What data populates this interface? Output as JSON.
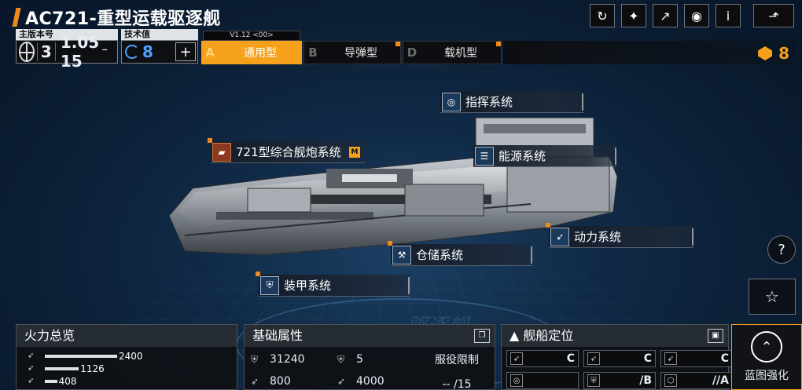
{
  "header": {
    "title": "AC721-重型运载驱逐舰"
  },
  "version_panel": {
    "label": "主版本号",
    "major": "3",
    "minor": "1.05",
    "sub": "15"
  },
  "tech_panel": {
    "label": "技术值",
    "value": "8"
  },
  "tabs": {
    "version_tag": "V1.12 <00>",
    "items": [
      {
        "letter": "A",
        "label": "通用型",
        "active": true
      },
      {
        "letter": "B",
        "label": "导弹型",
        "active": false
      },
      {
        "letter": "D",
        "label": "载机型",
        "active": false
      }
    ]
  },
  "currency": {
    "value": "8",
    "color": "#f5a11c"
  },
  "systems": {
    "command": "指挥系统",
    "energy": "能源系统",
    "cannon": "721型综合舰炮系统",
    "cannon_badge": "M",
    "power": "动力系统",
    "storage": "仓储系统",
    "armor": "装甲系统"
  },
  "floor_text": "驱逐舰",
  "firepower": {
    "title": "火力总览",
    "rows": [
      {
        "value": "2400",
        "fraction": 1.0
      },
      {
        "value": "1126",
        "fraction": 0.47
      },
      {
        "value": "408",
        "fraction": 0.17
      }
    ]
  },
  "attributes": {
    "title": "基础属性",
    "items": [
      {
        "value": "31240"
      },
      {
        "value": "5"
      },
      {
        "value": "800"
      },
      {
        "value": "4000"
      }
    ],
    "service_label": "服役限制",
    "service_value": "-- /15"
  },
  "positioning": {
    "title": "舰船定位",
    "cells": [
      {
        "grade": "C"
      },
      {
        "grade": "C"
      },
      {
        "grade": "C"
      },
      {
        "grade": ""
      },
      {
        "grade": "/B"
      },
      {
        "grade": "//A"
      }
    ]
  },
  "enhance": {
    "label": "蓝图强化"
  },
  "icons": {
    "refresh": "refresh-icon",
    "paint": "paint-icon",
    "share": "share-icon",
    "view": "eye-icon",
    "info": "info-icon",
    "back": "back-icon"
  },
  "colors": {
    "accent": "#f5a11c",
    "tech": "#4ca3ff"
  }
}
